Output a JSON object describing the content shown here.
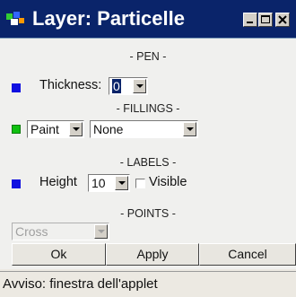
{
  "window": {
    "title": "Layer: Particelle",
    "icon": "applet-icon",
    "controls": [
      "minimize-icon",
      "maximize-icon",
      "close-icon"
    ],
    "title_bar_color": "#0a246a"
  },
  "pen": {
    "section_label": "- PEN -",
    "thickness_label": "Thickness:",
    "thickness_value": "0",
    "bullet_color": "#1010e0"
  },
  "fillings": {
    "section_label": "- FILLINGS -",
    "mode_value": "Paint",
    "pattern_value": "None",
    "bullet_color": "#10c010"
  },
  "labels": {
    "section_label": "- LABELS -",
    "height_label": "Height",
    "height_value": "10",
    "visible_label": "Visible",
    "visible_checked": false,
    "bullet_color": "#1010e0"
  },
  "points": {
    "section_label": "- POINTS -",
    "shape_value": "Cross",
    "disabled": true
  },
  "buttons": {
    "ok": "Ok",
    "apply": "Apply",
    "cancel": "Cancel"
  },
  "status_bar": {
    "text": "Avviso: finestra dell'applet"
  }
}
